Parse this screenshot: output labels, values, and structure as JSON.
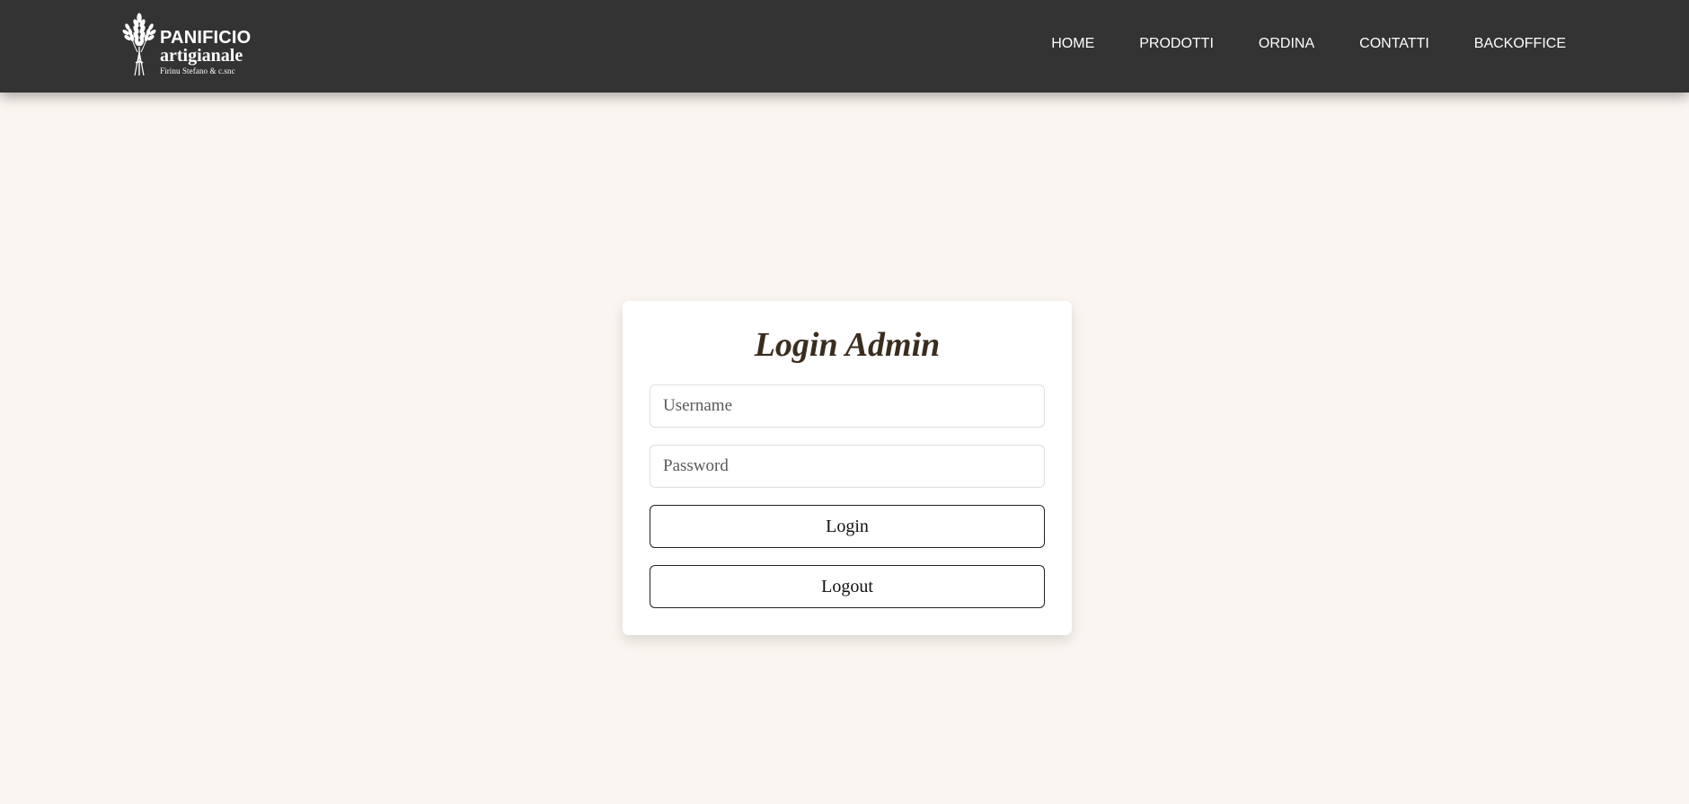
{
  "header": {
    "logo": {
      "line1": "PANIFICIO",
      "line2": "artigianale",
      "line3": "Firinu Stefano & c.snc"
    },
    "nav": [
      {
        "label": "HOME"
      },
      {
        "label": "PRODOTTI"
      },
      {
        "label": "ORDINA"
      },
      {
        "label": "CONTATTI"
      },
      {
        "label": "BACKOFFICE"
      }
    ]
  },
  "login": {
    "title": "Login Admin",
    "username_placeholder": "Username",
    "username_value": "",
    "password_placeholder": "Password",
    "password_value": "",
    "login_label": "Login",
    "logout_label": "Logout"
  },
  "colors": {
    "header_bg": "#333333",
    "page_bg": "#faf5f0",
    "title": "#3a2d1e",
    "card_bg": "#ffffff"
  }
}
